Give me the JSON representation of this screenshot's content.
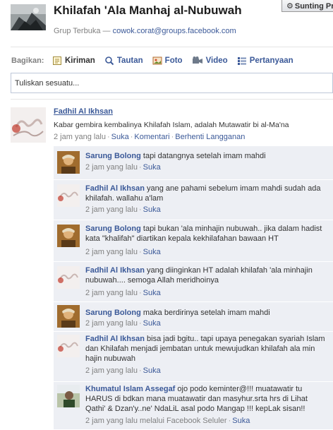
{
  "header": {
    "title": "Khilafah 'Ala Manhaj al-Nubuwah",
    "group_type": "Grup Terbuka",
    "dash": "—",
    "email": "cowok.corat@groups.facebook.com",
    "edit_button": "Sunting Pr"
  },
  "composer": {
    "share_label": "Bagikan:",
    "tabs": [
      {
        "label": "Kiriman",
        "icon": "post-icon"
      },
      {
        "label": "Tautan",
        "icon": "link-icon"
      },
      {
        "label": "Foto",
        "icon": "photo-icon"
      },
      {
        "label": "Video",
        "icon": "video-icon"
      },
      {
        "label": "Pertanyaan",
        "icon": "question-icon"
      }
    ],
    "placeholder": "Tuliskan sesuatu..."
  },
  "post": {
    "author": "Fadhil Al Ikhsan",
    "text": "Kabar gembira kembalinya Khilafah Islam, adalah Mutawatir bi al-Ma'na",
    "time": "2 jam yang lalu",
    "actions": [
      "Suka",
      "Komentari",
      "Berhenti Langganan"
    ]
  },
  "comments": [
    {
      "author": "Sarung Bolong",
      "text": "tapi datangnya setelah imam mahdi",
      "time": "2 jam yang lalu",
      "action": "Suka",
      "avatar": "sarung"
    },
    {
      "author": "Fadhil Al Ikhsan",
      "text": "yang ane pahami sebelum imam mahdi sudah ada khilafah. wallahu a'lam",
      "time": "2 jam yang lalu",
      "action": "Suka",
      "avatar": "fadhil"
    },
    {
      "author": "Sarung Bolong",
      "text": "tapi bukan 'ala minhajin nubuwah.. jika dalam hadist kata \"khalifah\" diartikan kepala kekhilafahan bawaan HT",
      "time": "2 jam yang lalu",
      "action": "Suka",
      "avatar": "sarung"
    },
    {
      "author": "Fadhil Al Ikhsan",
      "text": "yang diinginkan HT adalah khilafah 'ala minhajin nubuwah.... semoga Allah meridhoinya",
      "time": "2 jam yang lalu",
      "action": "Suka",
      "avatar": "fadhil"
    },
    {
      "author": "Sarung Bolong",
      "text": "maka berdirinya setelah imam mahdi",
      "time": "2 jam yang lalu",
      "action": "Suka",
      "avatar": "sarung"
    },
    {
      "author": "Fadhil Al Ikhsan",
      "text": "bisa jadi bgitu.. tapi upaya penegakan syariah Islam dan Khilafah menjadi jembatan untuk mewujudkan khilafah ala min hajin nubuwah",
      "time": "2 jam yang lalu",
      "action": "Suka",
      "avatar": "fadhil"
    },
    {
      "author": "Khumatul Islam Assegaf",
      "text": "ojo podo keminter@!!! muatawatir tu HARUS di bdkan mana muatawatir dan masyhur.srta hrs di Lihat Qathi' & Dzan'y..ne' NdaLiL asal podo Mangap !!! kepLak sisan!!",
      "time": "2 jam yang lalu melalui Facebook Seluler",
      "action": "Suka",
      "avatar": "khumatul"
    }
  ],
  "colors": {
    "link": "#3b5998",
    "comment_bg": "#edeff4",
    "meta": "#808080"
  }
}
